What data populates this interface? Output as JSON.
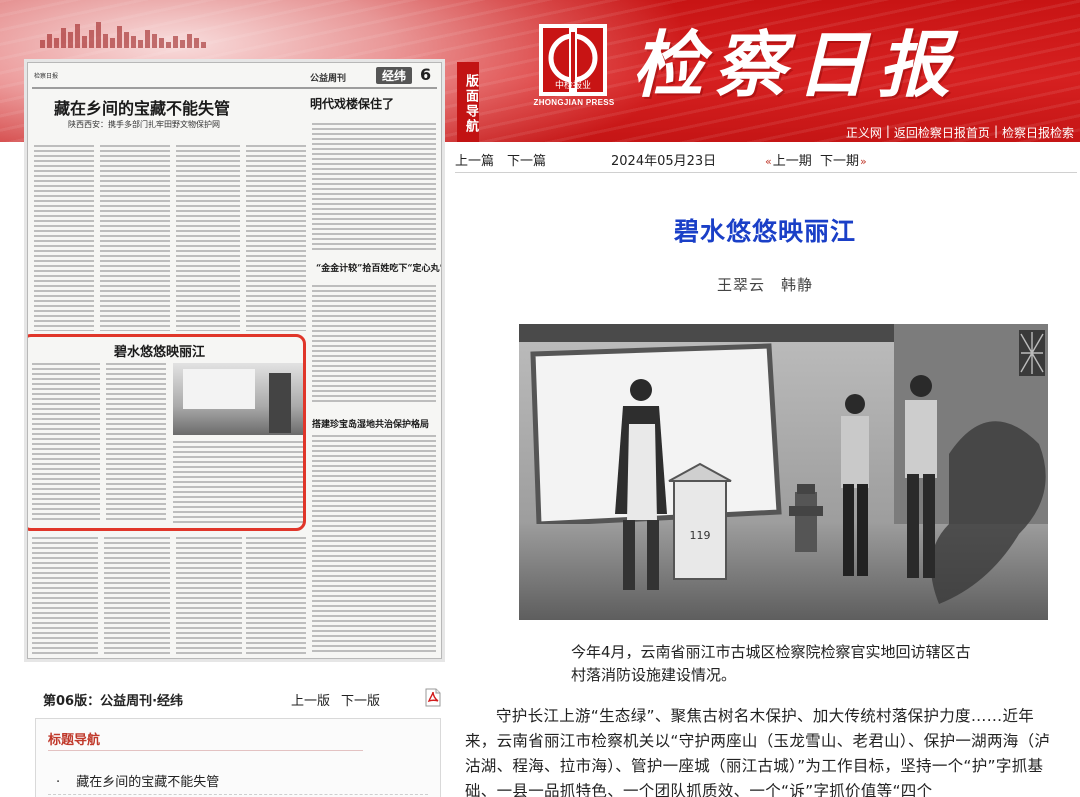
{
  "header": {
    "masthead": "检察日报",
    "press_logo_text": "ZHONGJIAN PRESS",
    "press_logo_cn": "中检报业",
    "links": [
      "正义网",
      "返回检察日报首页",
      "检察日报检索"
    ],
    "accent_color": "#c81414"
  },
  "side_tag": "版面导航",
  "thumbnail": {
    "page_number": "6",
    "section": "经纬",
    "column": "公益周刊",
    "headlines": {
      "main": "藏在乡间的宝藏不能失管",
      "main_sub": "陕西西安：携手多部门扎牢田野文物保护网",
      "side": "明代戏楼保住了",
      "middle": "“金金计较”拾百姓吃下“定心丸”",
      "highlight": "碧水悠悠映丽江",
      "lower": "搭建珍宝岛湿地共治保护格局"
    }
  },
  "edition": {
    "label": "第06版：公益周刊·经纬",
    "prev": "上一版",
    "next": "下一版",
    "pdf_icon": "pdf-icon"
  },
  "headline_nav": {
    "title": "标题导航",
    "items": [
      "藏在乡间的宝藏不能失管"
    ]
  },
  "article_nav": {
    "prev_article": "上一篇",
    "next_article": "下一篇",
    "date": "2024年05月23日",
    "prev_issue": "上一期",
    "next_issue": "下一期"
  },
  "article": {
    "title": "碧水悠悠映丽江",
    "authors": "王翠云　韩静",
    "caption": "今年4月，云南省丽江市古城区检察院检察官实地回访辖区古村落消防设施建设情况。",
    "body": "守护长江上游“生态绿”、聚焦古树名木保护、加大传统村落保护力度……近年来，云南省丽江市检察机关以“守护两座山（玉龙雪山、老君山）、保护一湖两海（泸沽湖、程海、拉市海）、管护一座城（丽江古城）”为工作目标，坚持一个“护”字抓基础、一县一品抓特色、一个团队抓质效、一个“诉”字抓价值等“四个"
  }
}
